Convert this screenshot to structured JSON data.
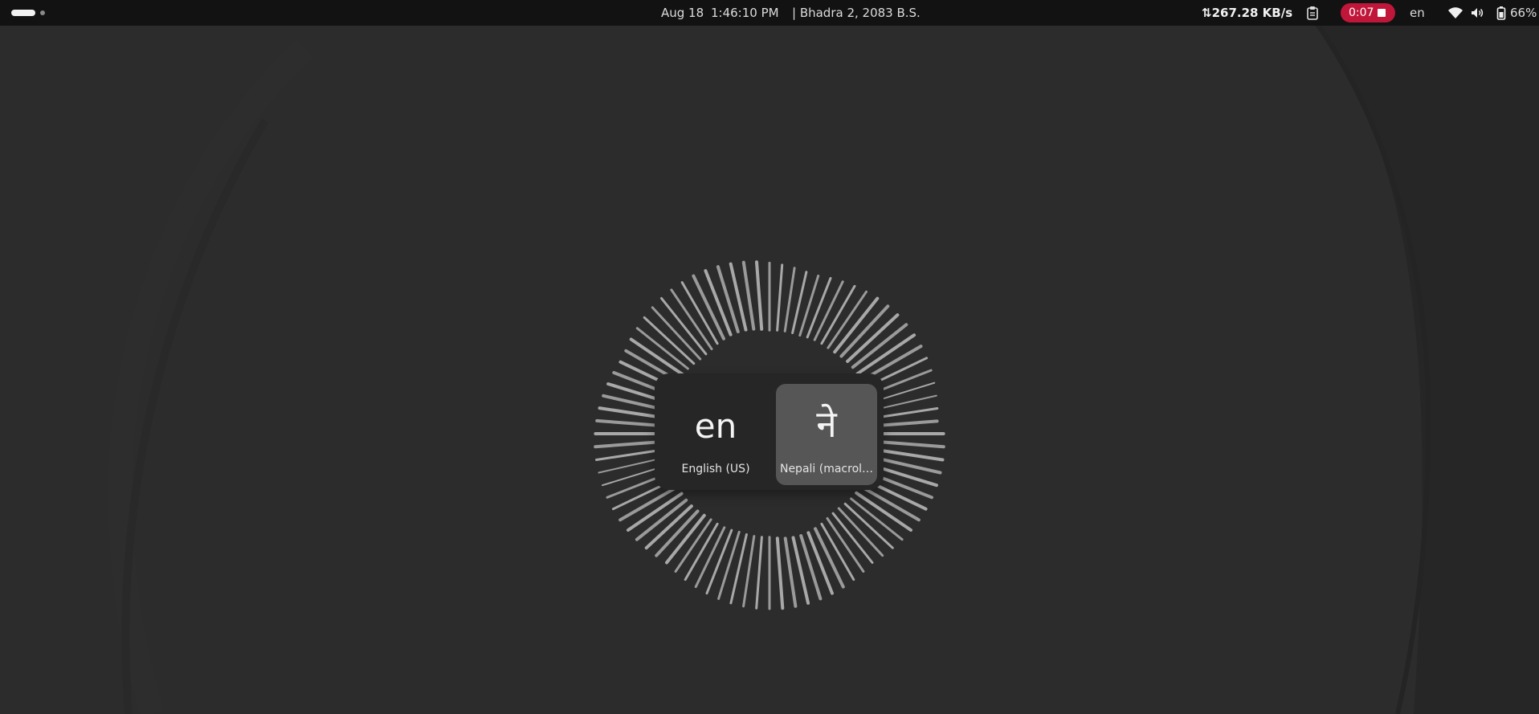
{
  "topbar": {
    "date": "Aug 18",
    "time": "1:46:10 PM",
    "bs_date": "| Bhadra 2, 2083 B.S.",
    "network_speed": "267.28 KB/s",
    "recording_time": "0:07",
    "keyboard_layout": "en",
    "battery": "66%"
  },
  "switcher": {
    "items": [
      {
        "glyph": "en",
        "label": "English (US)",
        "selected": false
      },
      {
        "glyph": "ने",
        "label": "Nepali (macrol…",
        "selected": true
      }
    ]
  },
  "colors": {
    "topbar_bg": "#121212",
    "desktop_bg": "#2b2b2b",
    "record_badge": "#c0163a",
    "selected_tile": "#565656"
  },
  "icons": [
    "workspace-indicator",
    "network-speed-icon",
    "clipboard-icon",
    "stop-icon",
    "wifi-icon",
    "volume-icon",
    "battery-icon"
  ]
}
